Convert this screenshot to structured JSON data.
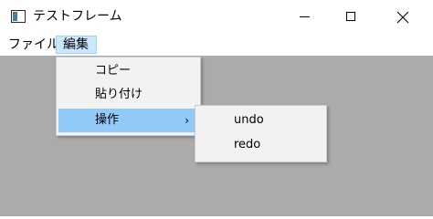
{
  "window": {
    "title": "テストフレーム"
  },
  "menubar": {
    "file_label": "ファイル",
    "edit_label": "編集"
  },
  "edit_menu": {
    "items": [
      {
        "label": "コピー"
      },
      {
        "label": "貼り付け"
      },
      {
        "label": "操作",
        "submenu_arrow": "›"
      }
    ]
  },
  "submenu": {
    "items": [
      {
        "label": "undo"
      },
      {
        "label": "redo"
      }
    ]
  },
  "colors": {
    "client_background": "#ababab",
    "menu_highlight": "#91c9f7",
    "menubar_active": "#cce8ff"
  }
}
